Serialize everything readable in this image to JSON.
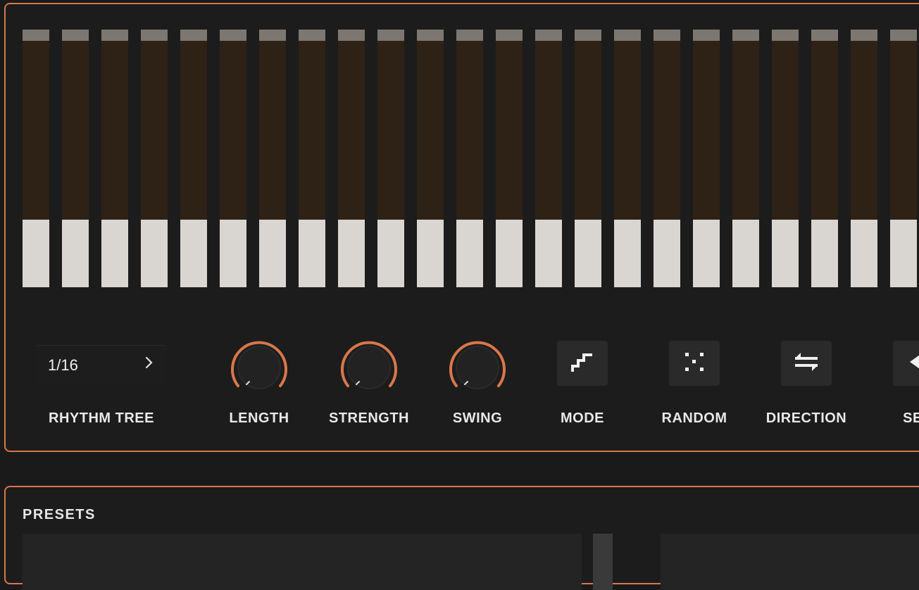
{
  "sequencer": {
    "steps": 24,
    "accent_color": "#d8774a",
    "step_cap_color": "#7c7770",
    "step_track_color": "#2e2115",
    "step_key_color": "#d9d6d2"
  },
  "controls": {
    "rhythm_tree": {
      "value": "1/16",
      "label": "RHYTHM TREE"
    },
    "knobs": [
      {
        "name": "length",
        "label": "LENGTH"
      },
      {
        "name": "strength",
        "label": "STRENGTH"
      },
      {
        "name": "swing",
        "label": "SWING"
      }
    ],
    "buttons": [
      {
        "name": "mode",
        "label": "MODE",
        "icon": "stairs-icon"
      },
      {
        "name": "random",
        "label": "RANDOM",
        "icon": "dice-dots-icon"
      },
      {
        "name": "direction",
        "label": "DIRECTION",
        "icon": "swap-arrows-icon"
      },
      {
        "name": "seq",
        "label": "SEQ",
        "icon": "arrow-left-icon"
      }
    ]
  },
  "presets": {
    "title": "PRESETS"
  }
}
